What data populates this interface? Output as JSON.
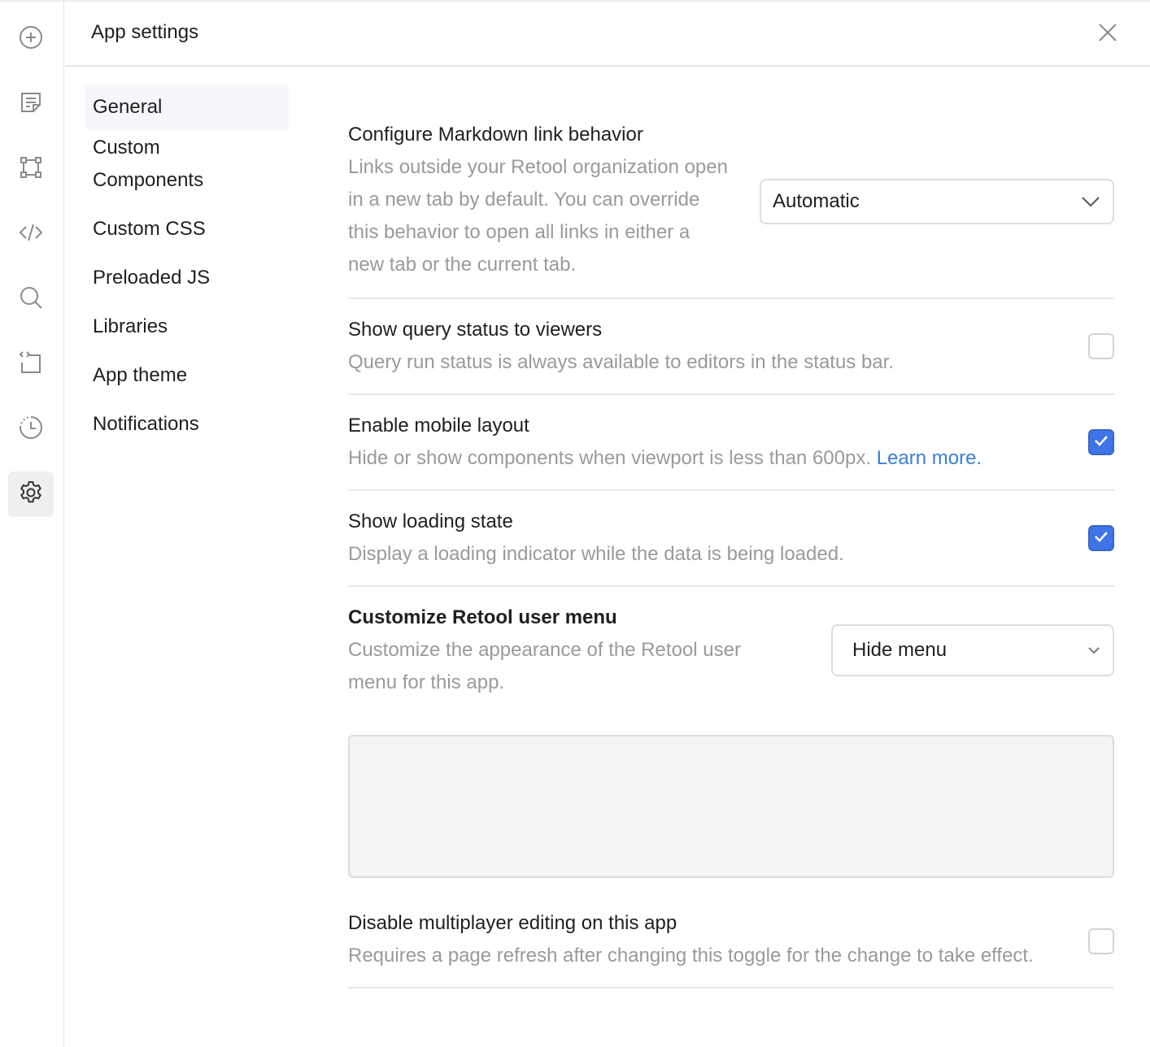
{
  "header": {
    "title": "App settings"
  },
  "rail": {
    "items": [
      {
        "icon": "plus-circle-icon"
      },
      {
        "icon": "document-icon"
      },
      {
        "icon": "component-frame-icon"
      },
      {
        "icon": "code-icon"
      },
      {
        "icon": "search-icon"
      },
      {
        "icon": "code-file-icon"
      },
      {
        "icon": "history-icon"
      },
      {
        "icon": "gear-icon",
        "active": true
      }
    ]
  },
  "nav": {
    "items": [
      {
        "label": "General",
        "active": true
      },
      {
        "label": "Custom\nComponents"
      },
      {
        "label": "Custom CSS"
      },
      {
        "label": "Preloaded JS"
      },
      {
        "label": "Libraries"
      },
      {
        "label": "App theme"
      },
      {
        "label": "Notifications"
      }
    ]
  },
  "settings": {
    "markdown_links": {
      "title": "Configure Markdown link behavior",
      "description": "Links outside your Retool organization open in a new tab by default. You can override this behavior to open all links in either a new tab or the current tab.",
      "value": "Automatic"
    },
    "query_status": {
      "title": "Show query status to viewers",
      "description": "Query run status is always available to editors in the status bar.",
      "checked": false
    },
    "mobile_layout": {
      "title": "Enable mobile layout",
      "description": "Hide or show components when viewport is less than 600px. ",
      "link": "Learn more.",
      "checked": true
    },
    "loading_state": {
      "title": "Show loading state",
      "description": "Display a loading indicator while the data is being loaded.",
      "checked": true
    },
    "user_menu": {
      "title": "Customize Retool user menu",
      "description": "Customize the appearance of the Retool user menu for this app.",
      "value": "Hide menu"
    },
    "multiplayer": {
      "title": "Disable multiplayer editing on this app",
      "description": "Requires a page refresh after changing this toggle for the change to take effect.",
      "checked": false
    }
  },
  "colors": {
    "accent": "#3f74e8",
    "link": "#3b7fd4",
    "muted_text": "#9a9a9a"
  }
}
